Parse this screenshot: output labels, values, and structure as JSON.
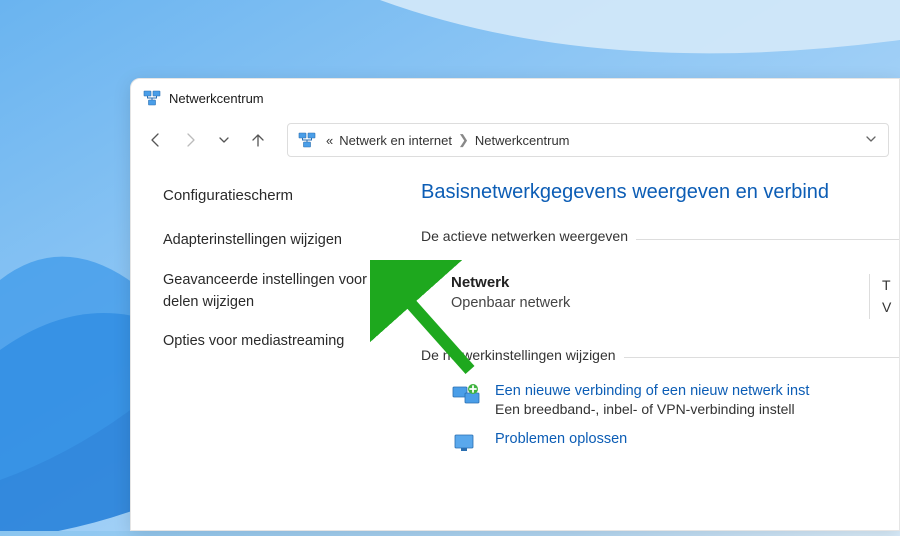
{
  "window": {
    "title": "Netwerkcentrum"
  },
  "breadcrumb": {
    "prefix": "«",
    "part1": "Netwerk en internet",
    "part2": "Netwerkcentrum"
  },
  "sidebar": {
    "heading": "Configuratiescherm",
    "links": [
      {
        "label": "Adapterinstellingen wijzigen"
      },
      {
        "label": "Geavanceerde instellingen voor delen wijzigen"
      },
      {
        "label": "Opties voor mediastreaming"
      }
    ]
  },
  "main": {
    "title": "Basisnetwerkgegevens weergeven en verbind",
    "section1": "De actieve netwerken weergeven",
    "network": {
      "name": "Netwerk",
      "type": "Openbaar netwerk",
      "right1": "T",
      "right2": "V"
    },
    "section2": "De netwerkinstellingen wijzigen",
    "item1": {
      "title": "Een nieuwe verbinding of een nieuw netwerk inst",
      "sub": "Een breedband-, inbel- of VPN-verbinding instell"
    },
    "item2": {
      "title": "Problemen oplossen"
    }
  }
}
